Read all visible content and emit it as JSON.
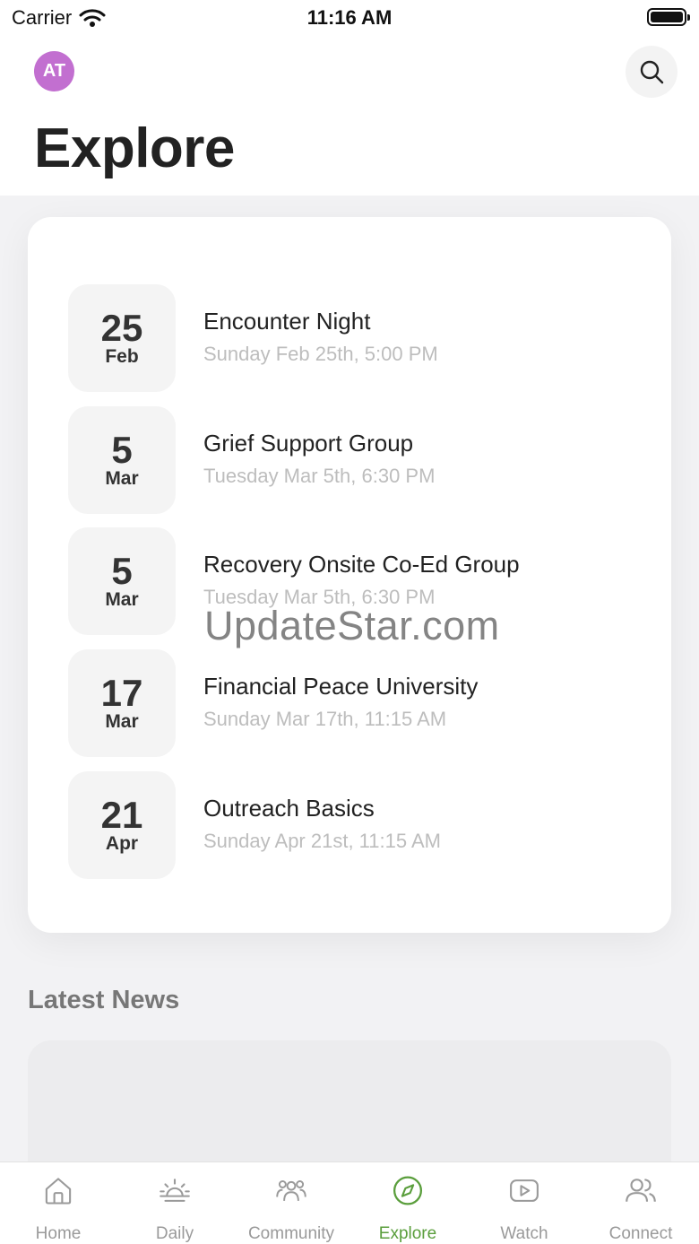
{
  "status_bar": {
    "carrier": "Carrier",
    "time": "11:16 AM"
  },
  "header": {
    "avatar_initials": "AT",
    "avatar_color": "#c26fd0",
    "title": "Explore",
    "search_icon": "search-icon"
  },
  "events": [
    {
      "day": "25",
      "month": "Feb",
      "title": "Encounter Night",
      "when": "Sunday Feb 25th, 5:00 PM"
    },
    {
      "day": "5",
      "month": "Mar",
      "title": "Grief Support Group",
      "when": "Tuesday Mar 5th, 6:30 PM"
    },
    {
      "day": "5",
      "month": "Mar",
      "title": "Recovery Onsite Co-Ed Group",
      "when": "Tuesday Mar 5th, 6:30 PM"
    },
    {
      "day": "17",
      "month": "Mar",
      "title": "Financial Peace University",
      "when": "Sunday Mar 17th, 11:15 AM"
    },
    {
      "day": "21",
      "month": "Apr",
      "title": "Outreach Basics",
      "when": "Sunday Apr 21st, 11:15 AM"
    }
  ],
  "watermark": "UpdateStar.com",
  "news": {
    "heading": "Latest News"
  },
  "tabs": [
    {
      "label": "Home",
      "icon": "home-icon",
      "active": false
    },
    {
      "label": "Daily",
      "icon": "sunrise-icon",
      "active": false
    },
    {
      "label": "Community",
      "icon": "community-icon",
      "active": false
    },
    {
      "label": "Explore",
      "icon": "compass-icon",
      "active": true
    },
    {
      "label": "Watch",
      "icon": "play-icon",
      "active": false
    },
    {
      "label": "Connect",
      "icon": "connect-icon",
      "active": false
    }
  ],
  "colors": {
    "accent": "#5a9e3c",
    "inactive": "#9a9a9a"
  }
}
